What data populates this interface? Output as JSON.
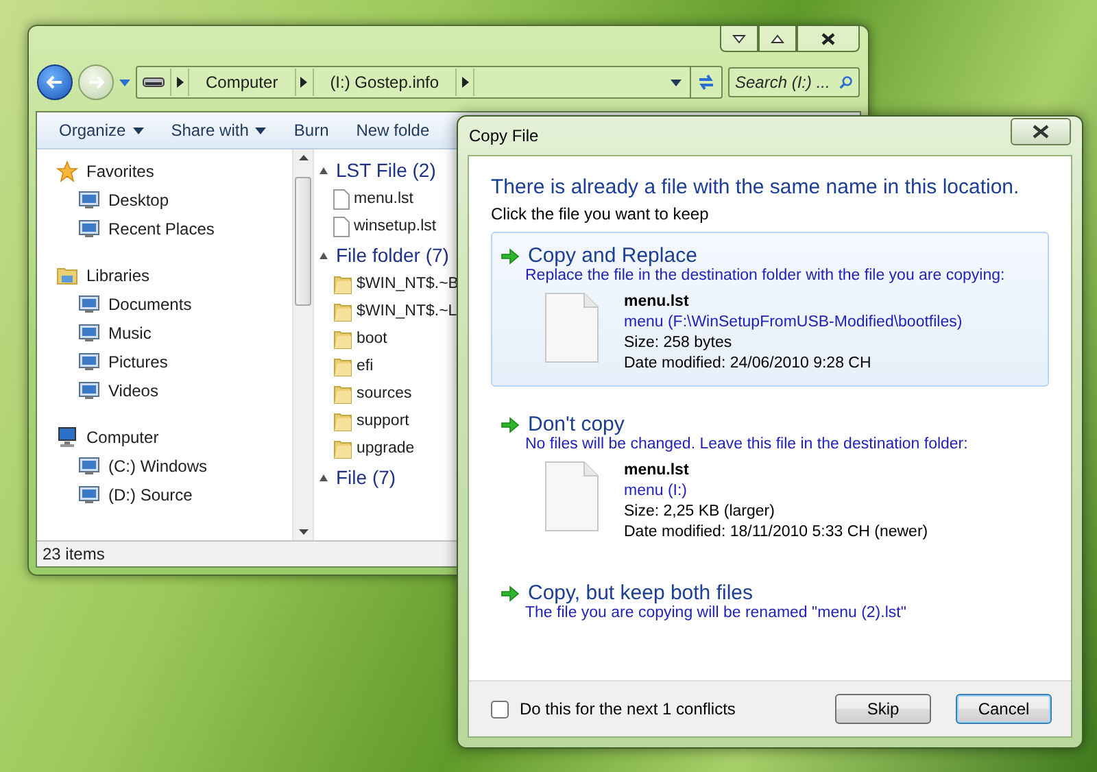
{
  "explorer": {
    "breadcrumbs": [
      "Computer",
      "(I:) Gostep.info"
    ],
    "search": {
      "placeholder": "Search (I:) ..."
    },
    "toolbar": [
      {
        "label": "Organize",
        "dropdown": true
      },
      {
        "label": "Share with",
        "dropdown": true
      },
      {
        "label": "Burn",
        "dropdown": false
      },
      {
        "label": "New folde",
        "dropdown": false
      }
    ],
    "nav": [
      {
        "label": "Favorites",
        "children": [
          {
            "label": "Desktop"
          },
          {
            "label": "Recent Places"
          }
        ]
      },
      {
        "label": "Libraries",
        "children": [
          {
            "label": "Documents"
          },
          {
            "label": "Music"
          },
          {
            "label": "Pictures"
          },
          {
            "label": "Videos"
          }
        ]
      },
      {
        "label": "Computer",
        "children": [
          {
            "label": "(C:) Windows"
          },
          {
            "label": "(D:) Source"
          }
        ]
      }
    ],
    "groups": [
      {
        "title": "LST File (2)",
        "kind": "file",
        "items": [
          "menu.lst",
          "winsetup.lst"
        ]
      },
      {
        "title": "File folder (7)",
        "kind": "folder",
        "items": [
          "$WIN_NT$.~B",
          "$WIN_NT$.~L",
          "boot",
          "efi",
          "sources",
          "support",
          "upgrade"
        ]
      },
      {
        "title": "File (7)"
      }
    ],
    "status": "23 items"
  },
  "dialog": {
    "title": "Copy File",
    "heading": "There is already a file with the same name in this location.",
    "subheading": "Click the file you want to keep",
    "options": [
      {
        "title": "Copy and Replace",
        "description": "Replace the file in the destination folder with the file you are copying:",
        "highlighted": true,
        "file": {
          "name": "menu.lst",
          "path": "menu (F:\\WinSetupFromUSB-Modified\\bootfiles)",
          "size": "Size: 258 bytes",
          "date": "Date modified: 24/06/2010 9:28 CH"
        }
      },
      {
        "title": "Don't copy",
        "description": "No files will be changed. Leave this file in the destination folder:",
        "highlighted": false,
        "file": {
          "name": "menu.lst",
          "path": "menu (I:)",
          "size": "Size: 2,25 KB (larger)",
          "date": "Date modified: 18/11/2010 5:33 CH (newer)"
        }
      },
      {
        "title": "Copy, but keep both files",
        "description": "The file you are copying will be renamed \"menu (2).lst\"",
        "highlighted": false
      }
    ],
    "checkbox": {
      "label": "Do this for the next 1 conflicts",
      "checked": false
    },
    "buttons": [
      {
        "label": "Skip",
        "default": false
      },
      {
        "label": "Cancel",
        "default": true
      }
    ]
  }
}
